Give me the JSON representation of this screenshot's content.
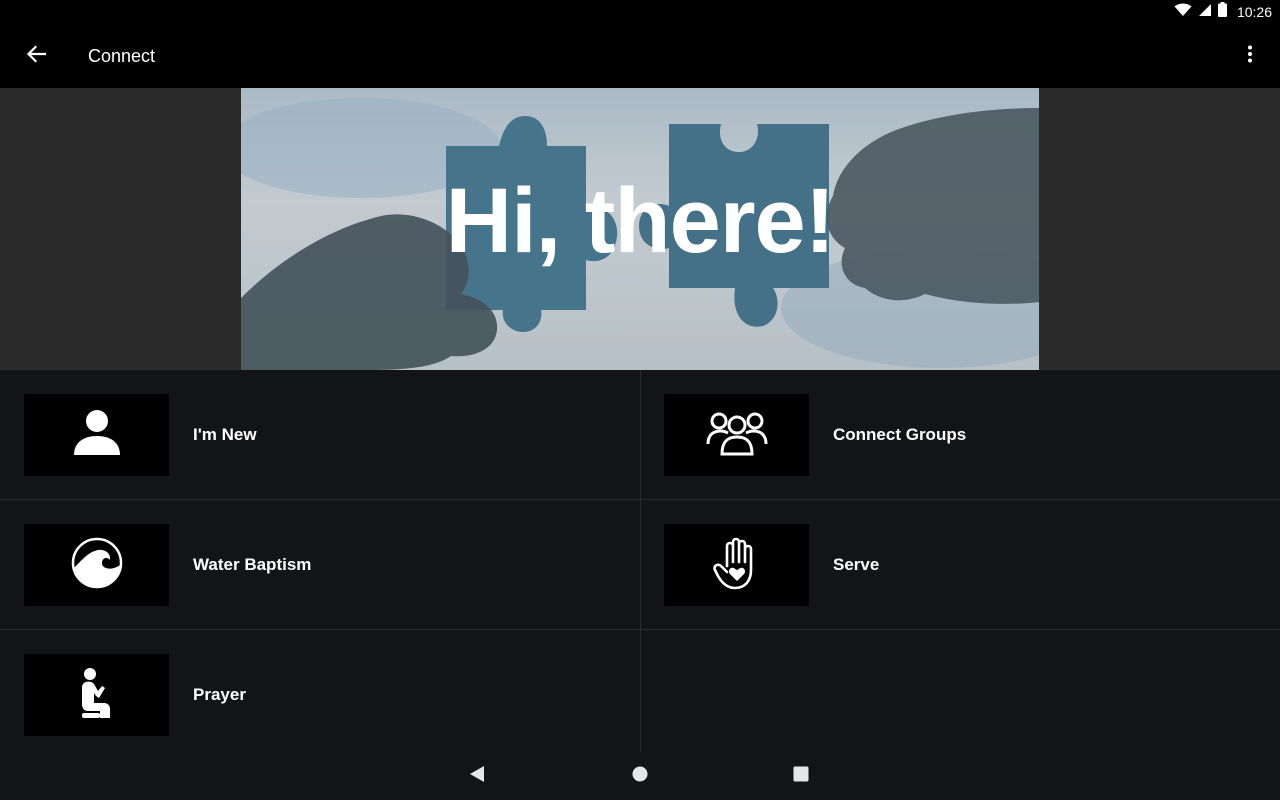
{
  "status_bar": {
    "time": "10:26",
    "icons": [
      "wifi-icon",
      "signal-icon",
      "battery-icon"
    ]
  },
  "app_bar": {
    "title": "Connect",
    "back_icon": "arrow-left-icon",
    "menu_icon": "more-vert-icon"
  },
  "banner": {
    "heading": "Hi, there!"
  },
  "tiles": [
    {
      "label": "I'm New",
      "icon": "person-icon"
    },
    {
      "label": "Connect Groups",
      "icon": "group-icon"
    },
    {
      "label": "Water Baptism",
      "icon": "wave-icon"
    },
    {
      "label": "Serve",
      "icon": "hand-heart-icon"
    },
    {
      "label": "Prayer",
      "icon": "praying-person-icon"
    }
  ],
  "nav_bar": {
    "icons": [
      "nav-back-icon",
      "nav-home-icon",
      "nav-recents-icon"
    ]
  },
  "colors": {
    "background": "#131417",
    "bar": "#000000",
    "tile_icon_bg": "#000000",
    "divider": "#2a2b2e",
    "text": "#ffffff"
  }
}
